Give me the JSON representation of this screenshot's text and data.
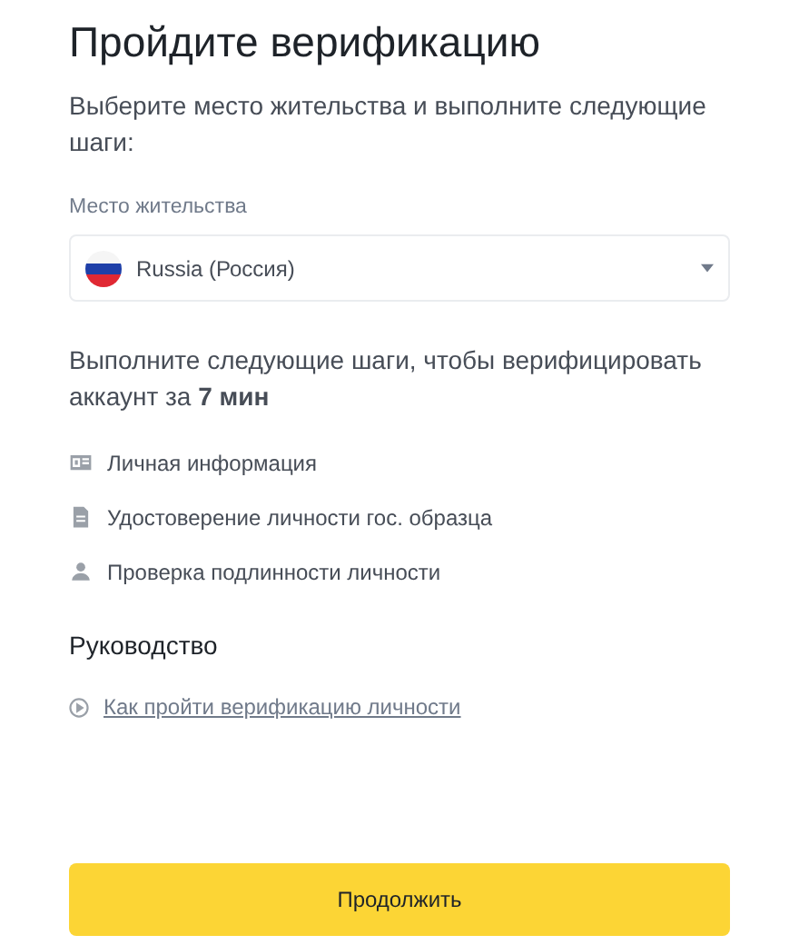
{
  "title": "Пройдите верификацию",
  "subtitle": "Выберите место жительства и выполните следующие шаги:",
  "residence": {
    "label": "Место жительства",
    "value": "Russia (Россия)"
  },
  "steps_intro": "Выполните следующие шаги, чтобы верифицировать аккаунт за **7 мин**",
  "steps": [
    {
      "kind": "info",
      "label": "Личная информация"
    },
    {
      "kind": "document",
      "label": "Удостоверение личности гос. образца"
    },
    {
      "kind": "person",
      "label": "Проверка подлинности личности"
    }
  ],
  "guide": {
    "title": "Руководство",
    "link": "Как пройти верификацию личности"
  },
  "continue_button": "Продолжить"
}
